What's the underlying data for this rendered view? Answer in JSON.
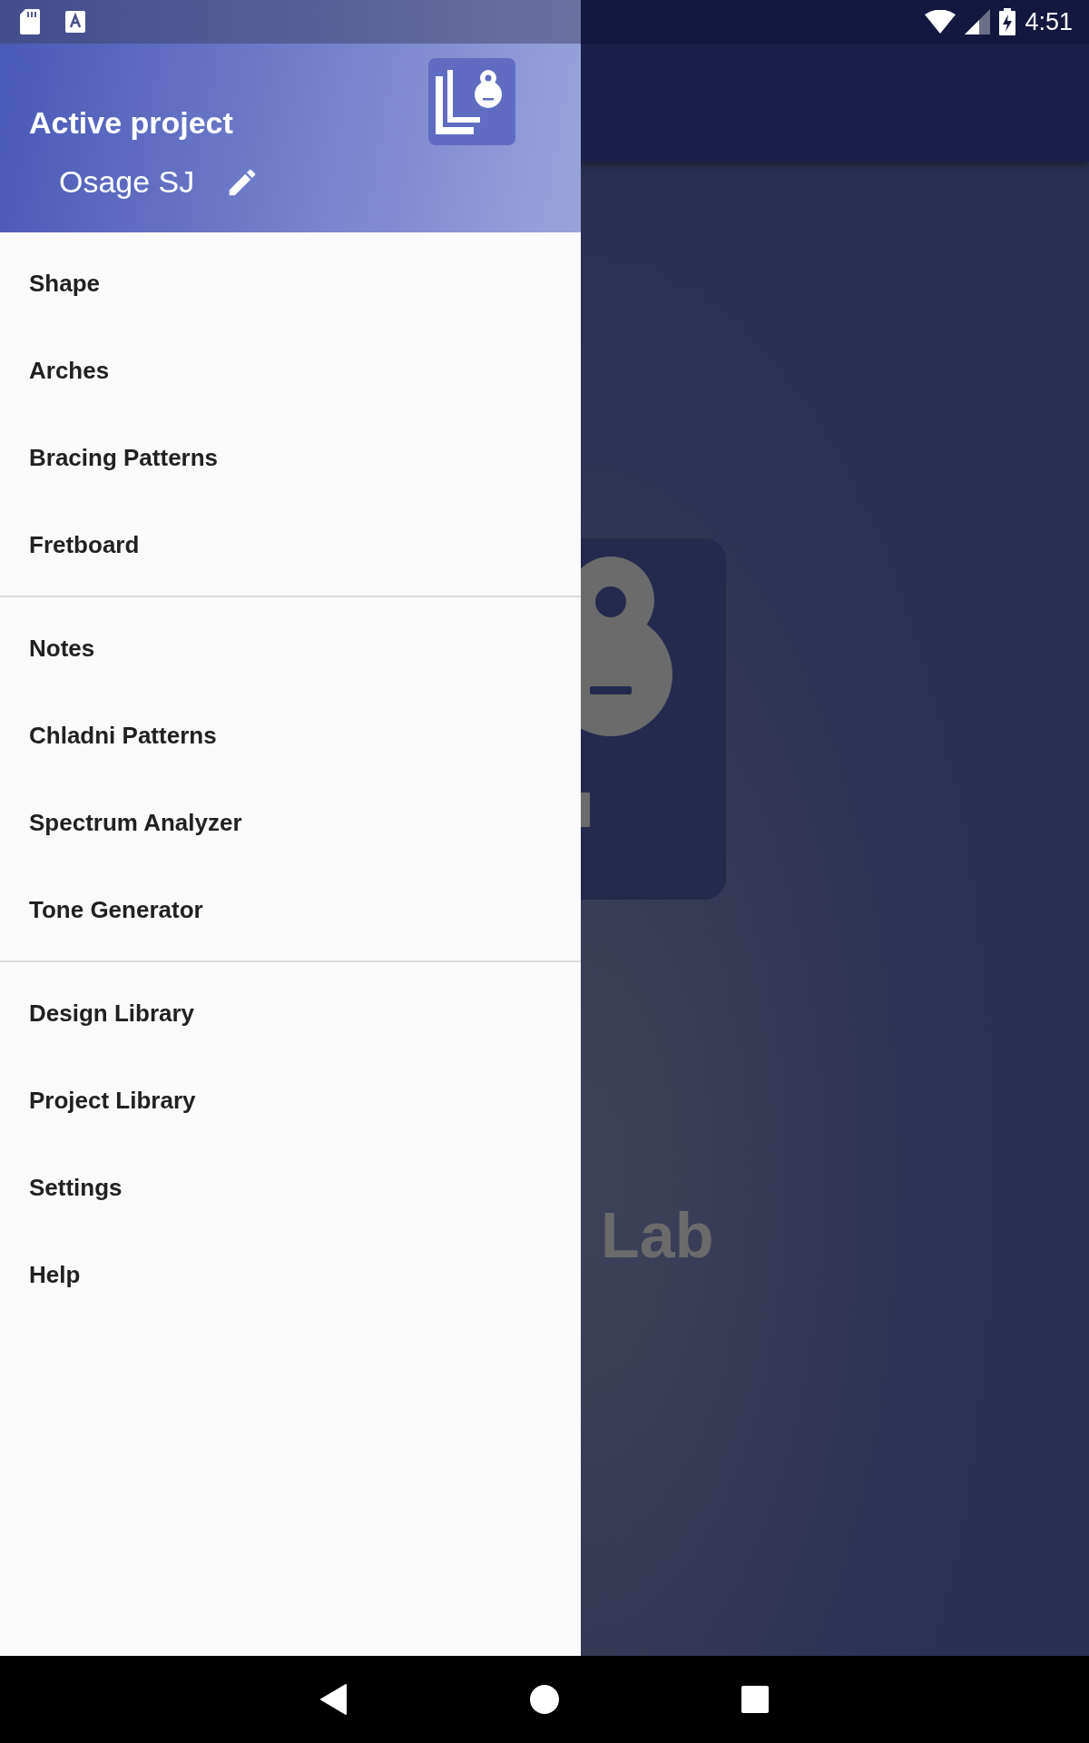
{
  "status_bar": {
    "time": "4:51"
  },
  "drawer": {
    "header": {
      "title": "Active project",
      "project": "Osage SJ"
    },
    "sections": [
      {
        "items": [
          {
            "label": "Shape"
          },
          {
            "label": "Arches"
          },
          {
            "label": "Bracing Patterns"
          },
          {
            "label": "Fretboard"
          }
        ]
      },
      {
        "items": [
          {
            "label": "Notes"
          },
          {
            "label": "Chladni Patterns"
          },
          {
            "label": "Spectrum Analyzer"
          },
          {
            "label": "Tone Generator"
          }
        ]
      },
      {
        "items": [
          {
            "label": "Design Library"
          },
          {
            "label": "Project Library"
          },
          {
            "label": "Settings"
          },
          {
            "label": "Help"
          }
        ]
      }
    ]
  },
  "background": {
    "title_fragment": "Lab"
  }
}
